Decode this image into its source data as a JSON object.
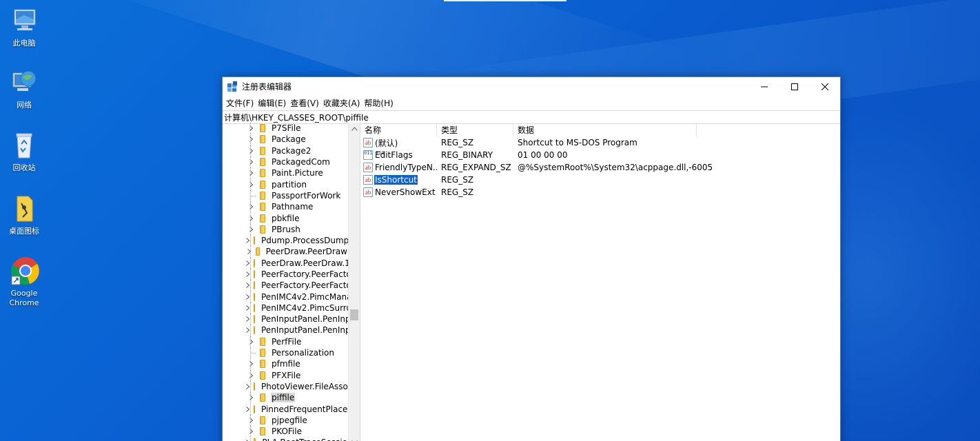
{
  "desktop": {
    "icons": [
      {
        "label": "此电脑"
      },
      {
        "label": "网络"
      },
      {
        "label": "回收站"
      },
      {
        "label": "桌面图标"
      },
      {
        "label": "Google Chrome"
      }
    ]
  },
  "window": {
    "title": "注册表编辑器",
    "menu": [
      "文件(F)",
      "编辑(E)",
      "查看(V)",
      "收藏夹(A)",
      "帮助(H)"
    ],
    "address": "计算机\\HKEY_CLASSES_ROOT\\piffile",
    "controls": {
      "minimize": "minimize-icon",
      "maximize": "maximize-icon",
      "close": "close-icon"
    }
  },
  "tree": {
    "items": [
      {
        "label": "P7SFile",
        "expandable": true
      },
      {
        "label": "Package",
        "expandable": true
      },
      {
        "label": "Package2",
        "expandable": true
      },
      {
        "label": "PackagedCom",
        "expandable": true
      },
      {
        "label": "Paint.Picture",
        "expandable": true
      },
      {
        "label": "partition",
        "expandable": true
      },
      {
        "label": "PassportForWork",
        "expandable": false
      },
      {
        "label": "Pathname",
        "expandable": true
      },
      {
        "label": "pbkfile",
        "expandable": true
      },
      {
        "label": "PBrush",
        "expandable": true
      },
      {
        "label": "Pdump.ProcessDump",
        "expandable": true
      },
      {
        "label": "PeerDraw.PeerDraw",
        "expandable": true
      },
      {
        "label": "PeerDraw.PeerDraw.1",
        "expandable": true
      },
      {
        "label": "PeerFactory.PeerFacto",
        "expandable": true
      },
      {
        "label": "PeerFactory.PeerFacto",
        "expandable": true
      },
      {
        "label": "PenIMC4v2.PimcMana",
        "expandable": true
      },
      {
        "label": "PenIMC4v2.PimcSurro",
        "expandable": true
      },
      {
        "label": "PenInputPanel.PenInp",
        "expandable": true
      },
      {
        "label": "PenInputPanel.PenInp",
        "expandable": true
      },
      {
        "label": "PerfFile",
        "expandable": true
      },
      {
        "label": "Personalization",
        "expandable": false
      },
      {
        "label": "pfmfile",
        "expandable": true
      },
      {
        "label": "PFXFile",
        "expandable": true
      },
      {
        "label": "PhotoViewer.FileAsso",
        "expandable": true
      },
      {
        "label": "piffile",
        "expandable": true,
        "selected": true
      },
      {
        "label": "PinnedFrequentPlace",
        "expandable": true
      },
      {
        "label": "pjpegfile",
        "expandable": true
      },
      {
        "label": "PKOFile",
        "expandable": true
      },
      {
        "label": "PLA.BootTraceSessio",
        "expandable": true
      }
    ]
  },
  "list": {
    "headers": {
      "name": "名称",
      "type": "类型",
      "data": "数据"
    },
    "rows": [
      {
        "name": "(默认)",
        "type": "REG_SZ",
        "data": "Shortcut to MS-DOS Program",
        "icon": "string-value-icon"
      },
      {
        "name": "EditFlags",
        "type": "REG_BINARY",
        "data": "01 00 00 00",
        "icon": "binary-value-icon"
      },
      {
        "name": "FriendlyTypeN...",
        "type": "REG_EXPAND_SZ",
        "data": "@%SystemRoot%\\System32\\acppage.dll,-6005",
        "icon": "string-value-icon"
      },
      {
        "name": "IsShortcut",
        "type": "REG_SZ",
        "data": "",
        "icon": "string-value-icon",
        "selected": true
      },
      {
        "name": "NeverShowExt",
        "type": "REG_SZ",
        "data": "",
        "icon": "string-value-icon"
      }
    ]
  }
}
